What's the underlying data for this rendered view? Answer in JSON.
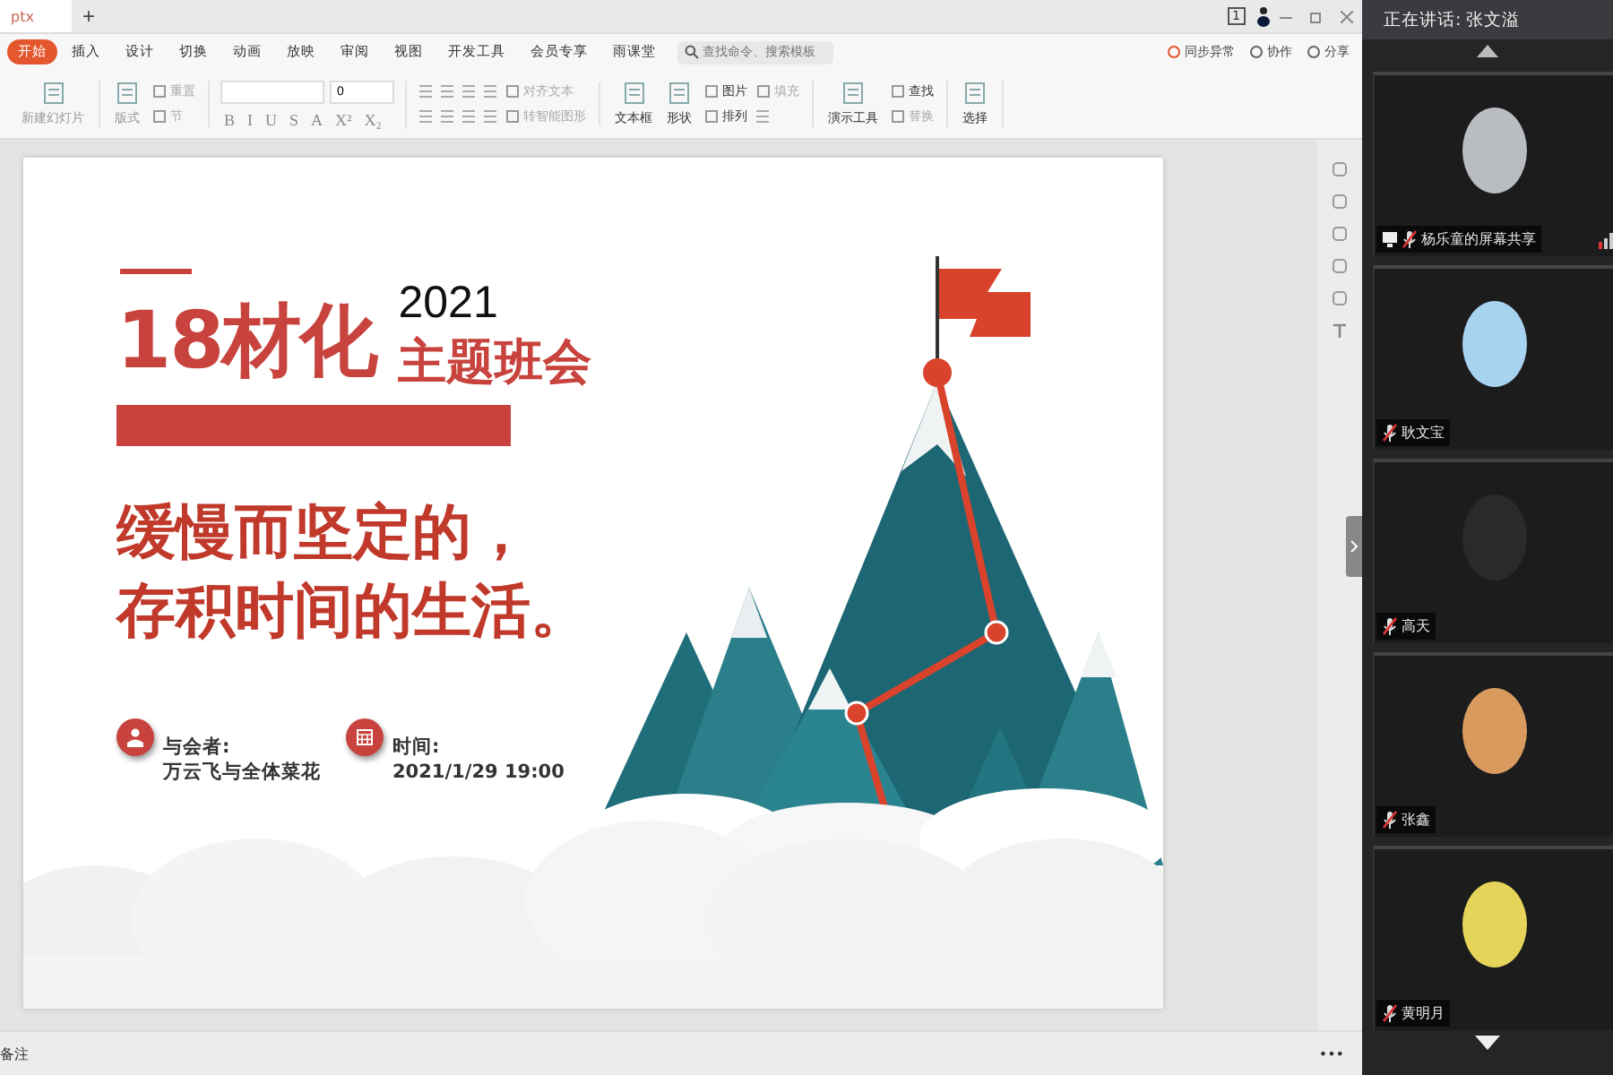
{
  "document_tab": {
    "title": "ptx",
    "new_tab": "+"
  },
  "window_controls": {
    "page_count": "1"
  },
  "ribbon_tabs": [
    {
      "label": "开始",
      "selected": true
    },
    {
      "label": "插入",
      "selected": false
    },
    {
      "label": "设计",
      "selected": false
    },
    {
      "label": "切换",
      "selected": false
    },
    {
      "label": "动画",
      "selected": false
    },
    {
      "label": "放映",
      "selected": false
    },
    {
      "label": "审阅",
      "selected": false
    },
    {
      "label": "视图",
      "selected": false
    },
    {
      "label": "开发工具",
      "selected": false
    },
    {
      "label": "会员专享",
      "selected": false
    },
    {
      "label": "雨课堂",
      "selected": false
    }
  ],
  "command_search": {
    "placeholder": "查找命令、搜索模板"
  },
  "ribbon_actions": [
    {
      "label": "同步异常"
    },
    {
      "label": "协作"
    },
    {
      "label": "分享"
    }
  ],
  "toolbar_groups": [
    {
      "items": [
        {
          "kind": "large",
          "label": "新建幻灯片",
          "disabled": true
        }
      ]
    },
    {
      "items": [
        {
          "kind": "large",
          "label": "版式",
          "disabled": true
        }
      ],
      "rows": [
        [
          {
            "kind": "small",
            "label": "重置",
            "disabled": true
          }
        ],
        [
          {
            "kind": "small",
            "label": "节",
            "disabled": true
          }
        ]
      ]
    },
    {
      "font_size": "0",
      "format_buttons": [
        "B",
        "I",
        "U",
        "S",
        "A",
        "X²",
        "X₂"
      ]
    },
    {
      "rows": [
        [
          {
            "kind": "icon"
          },
          {
            "kind": "icon"
          },
          {
            "kind": "icon"
          },
          {
            "kind": "icon"
          },
          {
            "kind": "small",
            "label": "对齐文本",
            "disabled": true
          }
        ],
        [
          {
            "kind": "icon"
          },
          {
            "kind": "icon"
          },
          {
            "kind": "icon"
          },
          {
            "kind": "icon"
          },
          {
            "kind": "small",
            "label": "转智能图形",
            "disabled": true
          }
        ]
      ]
    },
    {
      "items": [
        {
          "kind": "large",
          "label": "文本框",
          "disabled": false
        },
        {
          "kind": "large",
          "label": "形状",
          "disabled": false
        }
      ],
      "rows": [
        [
          {
            "kind": "small",
            "label": "图片",
            "disabled": false
          },
          {
            "kind": "small",
            "label": "填充",
            "disabled": true
          }
        ],
        [
          {
            "kind": "small",
            "label": "排列",
            "disabled": false
          },
          {
            "kind": "icon"
          }
        ]
      ]
    },
    {
      "items": [
        {
          "kind": "large",
          "label": "演示工具",
          "disabled": false
        }
      ],
      "rows": [
        [
          {
            "kind": "small",
            "label": "查找",
            "disabled": false
          }
        ],
        [
          {
            "kind": "small",
            "label": "替换",
            "disabled": true
          }
        ]
      ]
    },
    {
      "items": [
        {
          "kind": "large",
          "label": "选择",
          "disabled": false
        }
      ]
    }
  ],
  "slide": {
    "class_name": "18材化",
    "year": "2021",
    "title": "主题班会",
    "slogan_lines": [
      "缓慢而坚定的，",
      "存积时间的生活。"
    ],
    "info": [
      {
        "kind": "person",
        "label": "与会者:",
        "value": "万云飞与全体菜花"
      },
      {
        "kind": "calendar",
        "label": "时间:",
        "value": "2021/1/29  19:00"
      }
    ]
  },
  "status_bar": {
    "notes": "备注",
    "more": "•••"
  },
  "meeting_panel": {
    "speaking": "正在讲话: 张文溢",
    "participants": [
      {
        "name": "杨乐童的屏幕共享",
        "sharing": true,
        "muted": true
      },
      {
        "name": "耿文宝",
        "sharing": false,
        "muted": true
      },
      {
        "name": "高天",
        "sharing": false,
        "muted": true
      },
      {
        "name": "张鑫",
        "sharing": false,
        "muted": true
      },
      {
        "name": "黄明月",
        "sharing": false,
        "muted": true
      }
    ]
  }
}
